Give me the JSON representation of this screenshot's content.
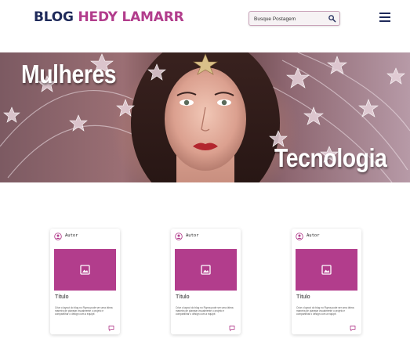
{
  "header": {
    "logo_part1": "BLOG",
    "logo_part2": "HEDY LAMARR",
    "search_placeholder": "Busque Postagem",
    "search_icon": "search-icon",
    "menu_icon": "hamburger-menu-icon"
  },
  "hero": {
    "word_left": "Mulheres",
    "word_right": "Tecnologia",
    "image": "portrait-with-stars"
  },
  "colors": {
    "brand_dark": "#1f2a5a",
    "brand_pink": "#b23d8c"
  },
  "cards": [
    {
      "author": "Autor",
      "title": "Título",
      "text": "Criar o layout do blog no Figma pode ser uma ótima maneira de planejar visualmente o projeto e compartilhar o design com a equipe."
    },
    {
      "author": "Autor",
      "title": "Título",
      "text": "Criar o layout do blog no Figma pode ser uma ótima maneira de planejar visualmente o projeto e compartilhar o design com a equipe."
    },
    {
      "author": "Autor",
      "title": "Título",
      "text": "Criar o layout do blog no Figma pode ser uma ótima maneira de planejar visualmente o projeto e compartilhar o design com a equipe."
    }
  ]
}
